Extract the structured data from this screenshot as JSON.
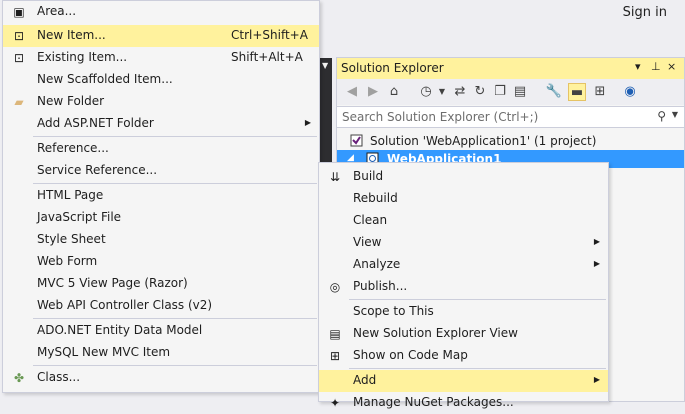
{
  "header": {
    "sign_in": "Sign in"
  },
  "solution_explorer": {
    "title": "Solution Explorer",
    "title_controls": [
      "▾",
      "⊥",
      "×"
    ],
    "search_placeholder": "Search Solution Explorer (Ctrl+;)",
    "solution_label": "Solution 'WebApplication1' (1 project)",
    "project_label": "WebApplication1"
  },
  "add_menu": {
    "items": [
      {
        "label": "Area...",
        "shortcut": "",
        "icon": "area-icon"
      },
      {
        "label": "New Item...",
        "shortcut": "Ctrl+Shift+A",
        "icon": "new-item-icon"
      },
      {
        "label": "Existing Item...",
        "shortcut": "Shift+Alt+A",
        "icon": "existing-item-icon"
      },
      {
        "label": "New Scaffolded Item...",
        "shortcut": ""
      },
      {
        "label": "New Folder",
        "shortcut": "",
        "icon": "folder-icon"
      },
      {
        "label": "Add ASP.NET Folder",
        "shortcut": ""
      },
      {
        "label": "Reference...",
        "shortcut": ""
      },
      {
        "label": "Service Reference...",
        "shortcut": ""
      },
      {
        "label": "HTML Page",
        "shortcut": ""
      },
      {
        "label": "JavaScript File",
        "shortcut": ""
      },
      {
        "label": "Style Sheet",
        "shortcut": ""
      },
      {
        "label": "Web Form",
        "shortcut": ""
      },
      {
        "label": "MVC 5 View Page (Razor)",
        "shortcut": ""
      },
      {
        "label": "Web API Controller Class (v2)",
        "shortcut": ""
      },
      {
        "label": "ADO.NET Entity Data Model",
        "shortcut": ""
      },
      {
        "label": "MySQL New MVC Item",
        "shortcut": ""
      },
      {
        "label": "Class...",
        "shortcut": "",
        "icon": "class-icon"
      }
    ]
  },
  "context_menu": {
    "items": [
      {
        "label": "Build",
        "icon": "build-icon"
      },
      {
        "label": "Rebuild"
      },
      {
        "label": "Clean"
      },
      {
        "label": "View"
      },
      {
        "label": "Analyze"
      },
      {
        "label": "Publish...",
        "icon": "publish-icon"
      },
      {
        "label": "Scope to This"
      },
      {
        "label": "New Solution Explorer View",
        "icon": "new-view-icon"
      },
      {
        "label": "Show on Code Map",
        "icon": "code-map-icon"
      },
      {
        "label": "Add"
      },
      {
        "label": "Manage NuGet Packages..."
      }
    ]
  },
  "colors": {
    "highlight": "#fff29d",
    "selection": "#3399ff",
    "menu_bg": "#f5f5f5",
    "border": "#cccedb"
  }
}
